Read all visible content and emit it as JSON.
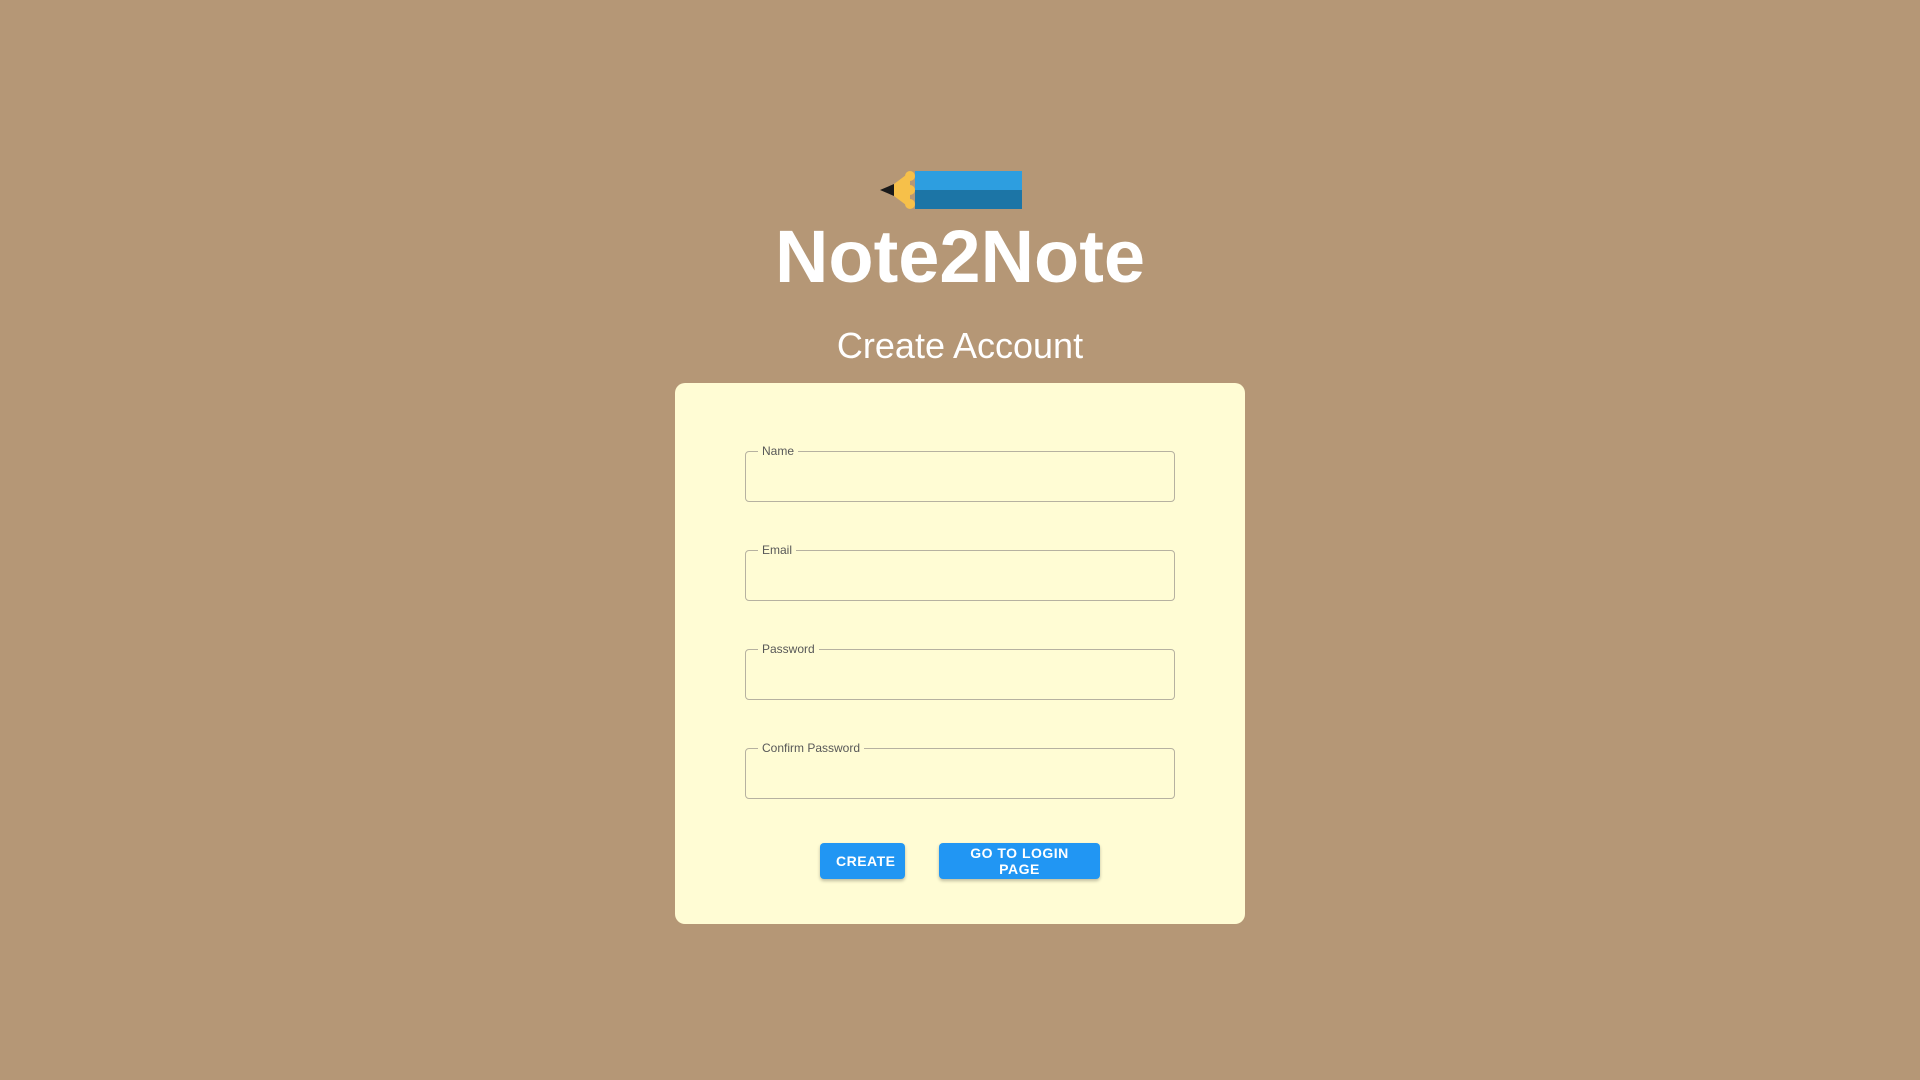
{
  "app": {
    "title": "Note2Note",
    "logo_icon": "pencil-icon"
  },
  "page": {
    "subtitle": "Create Account"
  },
  "form": {
    "fields": [
      {
        "label": "Name",
        "value": ""
      },
      {
        "label": "Email",
        "value": ""
      },
      {
        "label": "Password",
        "value": ""
      },
      {
        "label": "Confirm Password",
        "value": ""
      }
    ],
    "create_label": "CREATE",
    "login_label": "GO TO LOGIN PAGE"
  },
  "colors": {
    "background": "#b59776",
    "card": "#fffcd4",
    "button": "#2196f3",
    "text_light": "#ffffff"
  }
}
